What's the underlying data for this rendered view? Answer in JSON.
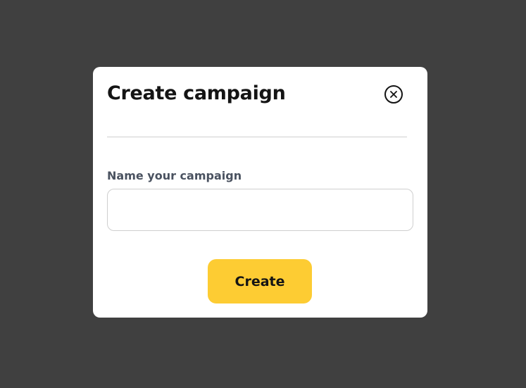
{
  "modal": {
    "title": "Create campaign",
    "close_icon": "close-circle-icon",
    "field_label": "Name your campaign",
    "field_value": "",
    "field_placeholder": "",
    "submit_label": "Create"
  },
  "colors": {
    "backdrop": "#404040",
    "accent": "#fdcc33",
    "title_text": "#141414",
    "label_text": "#4a5260"
  }
}
